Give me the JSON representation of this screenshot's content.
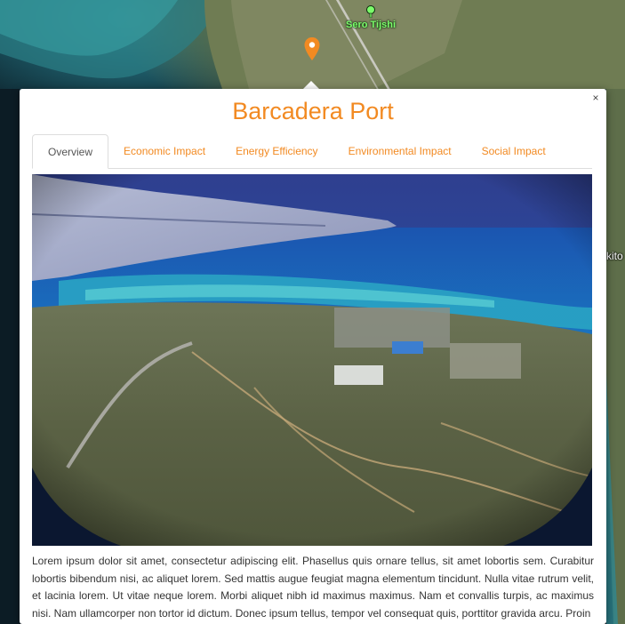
{
  "map": {
    "poi_label": "Sero Tijshi",
    "edge_label": "kito",
    "marker": "map-pin-icon",
    "poi_icon": "tree-icon"
  },
  "popup": {
    "title": "Barcadera Port",
    "close_label": "×",
    "tabs": [
      {
        "label": "Overview",
        "active": true
      },
      {
        "label": "Economic Impact",
        "active": false
      },
      {
        "label": "Energy Efficiency",
        "active": false
      },
      {
        "label": "Environmental Impact",
        "active": false
      },
      {
        "label": "Social Impact",
        "active": false
      }
    ],
    "image": "aerial photo of port from airplane window",
    "body": "Lorem ipsum dolor sit amet, consectetur adipiscing elit. Phasellus quis ornare tellus, sit amet lobortis sem. Curabitur lobortis bibendum nisi, ac aliquet lorem. Sed mattis augue feugiat magna elementum tincidunt. Nulla vitae rutrum velit, et lacinia lorem. Ut vitae neque lorem. Morbi aliquet nibh id maximus maximus. Nam et convallis turpis, ac maximus nisi. Nam ullamcorper non tortor id dictum. Donec ipsum tellus, tempor vel consequat quis, porttitor gravida arcu. Proin"
  },
  "colors": {
    "accent": "#f28a22",
    "active_tab_text": "#555555",
    "poi_label": "#7CFC6b"
  }
}
